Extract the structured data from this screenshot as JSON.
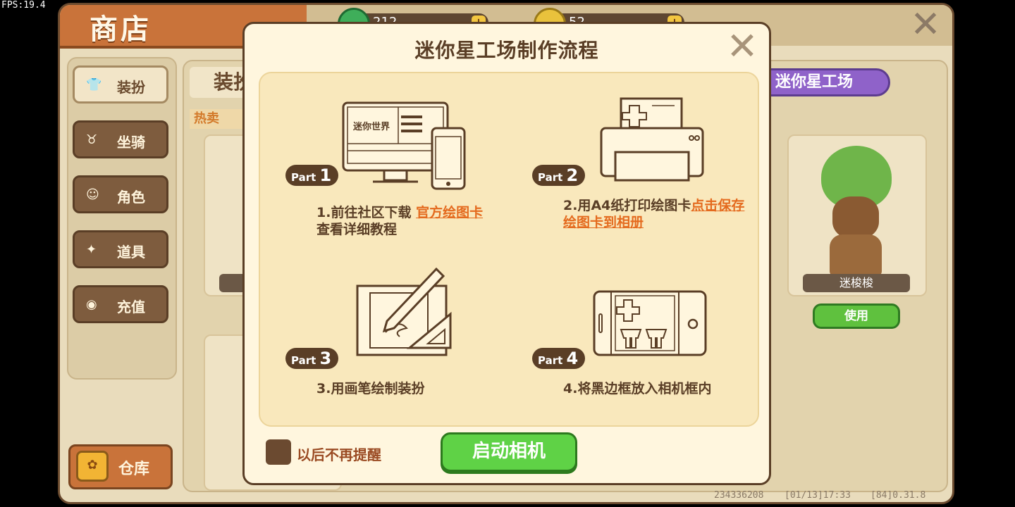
{
  "fps": "FPS:19.4",
  "shop": {
    "title": "商店",
    "resource_1": "212",
    "resource_2": "52",
    "plus": "+"
  },
  "sidebar": {
    "items": [
      {
        "label": "装扮",
        "icon": "shirt-icon"
      },
      {
        "label": "坐骑",
        "icon": "mount-icon"
      },
      {
        "label": "角色",
        "icon": "character-icon"
      },
      {
        "label": "道具",
        "icon": "item-icon"
      },
      {
        "label": "充值",
        "icon": "coins-icon"
      }
    ],
    "warehouse": "仓库"
  },
  "content": {
    "tab": "装扮",
    "hot": "热卖",
    "mini_workshop_btn": "迷你星工场",
    "card_name": "迷梭梭",
    "use_btn": "使用",
    "footer_id": "234336208",
    "footer_time": "[01/13]17:33",
    "footer_ver": "[84]0.31.8"
  },
  "modal": {
    "title": "迷你星工场制作流程",
    "close": "×",
    "steps": [
      {
        "part": "Part",
        "num": "1",
        "text_a": "1.前往社区下载 ",
        "link_a": "官方绘图卡",
        "text_b": "查看详细教程"
      },
      {
        "part": "Part",
        "num": "2",
        "text_a": "2.用A4纸打印绘图卡",
        "link_a": "点击保存绘图卡到相册",
        "text_b": ""
      },
      {
        "part": "Part",
        "num": "3",
        "text_a": "3.用画笔绘制装扮",
        "link_a": "",
        "text_b": ""
      },
      {
        "part": "Part",
        "num": "4",
        "text_a": "4.将黑边框放入相机框内",
        "link_a": "",
        "text_b": ""
      }
    ],
    "monitor_logo": "迷你世界",
    "dont_remind": "以后不再提醒",
    "start_camera": "启动相机"
  },
  "colors": {
    "accent_orange": "#e46a1e",
    "button_green": "#5fd246",
    "dark_brown": "#5a3e26"
  }
}
